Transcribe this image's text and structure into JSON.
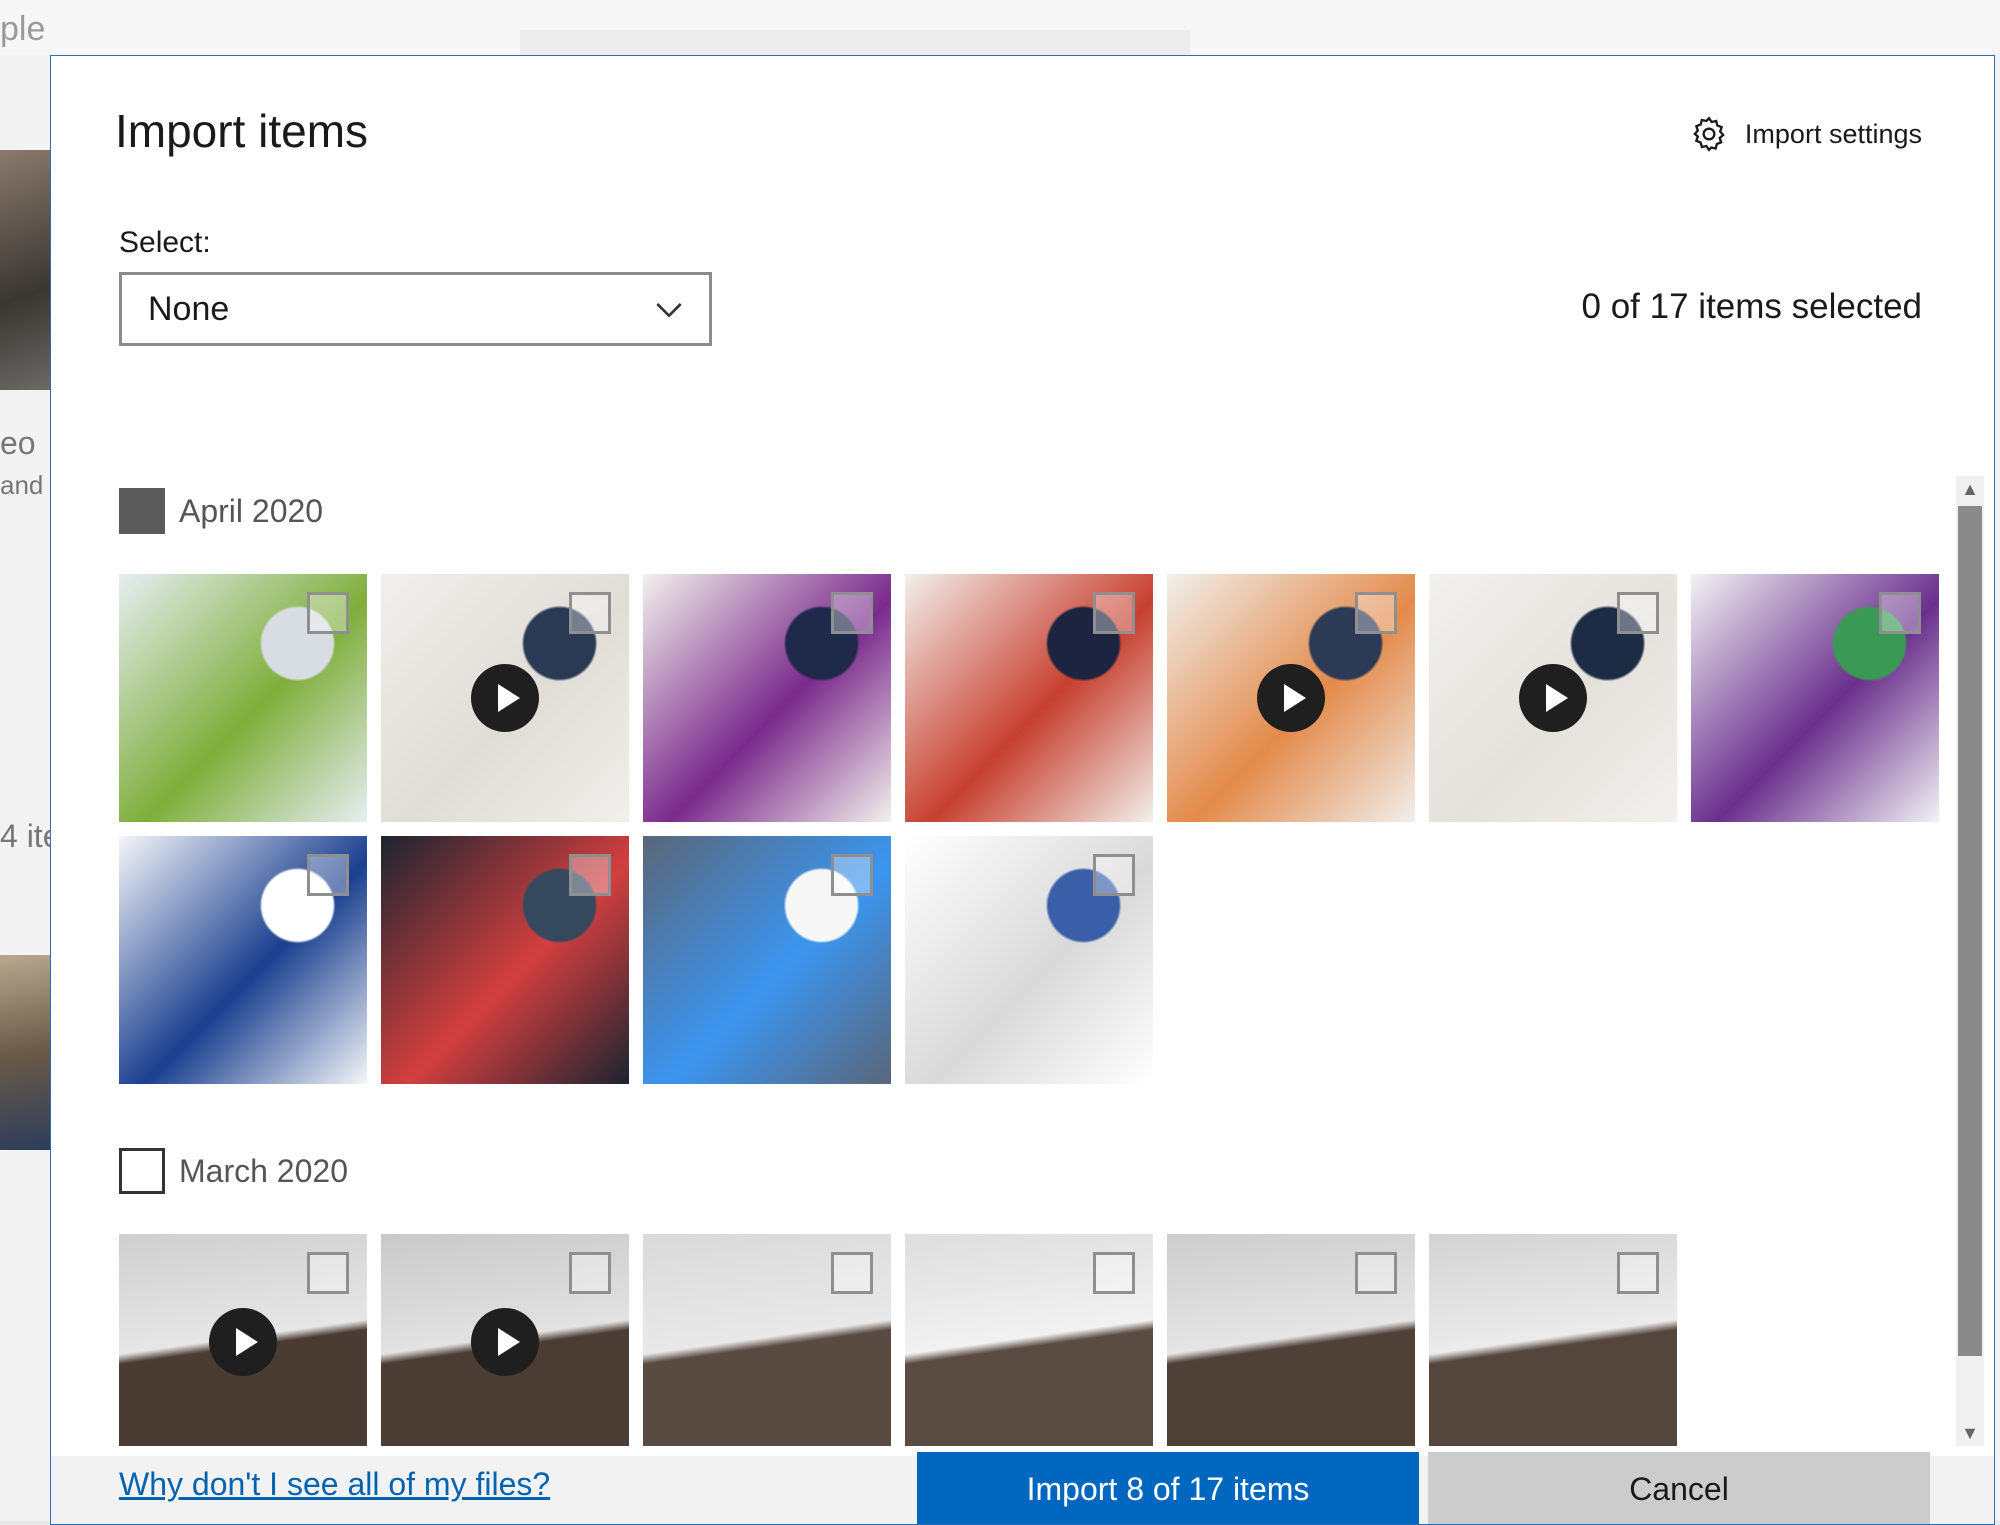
{
  "background_app": {
    "title_fragment": "ple",
    "side_text_1": "eo",
    "side_text_2": "and s",
    "side_text_3": "4 ite"
  },
  "dialog": {
    "title": "Import items",
    "settings_label": "Import settings",
    "settings_icon": "gear-icon",
    "select_label": "Select:",
    "select_value": "None",
    "selection_count": "0 of 17 items selected"
  },
  "groups": [
    {
      "label": "April 2020",
      "checked_state": "partial",
      "items": [
        {
          "kind": "photo",
          "video": false,
          "colors": [
            "#e6eef2",
            "#7fae3c",
            "#d7dde3"
          ]
        },
        {
          "kind": "video",
          "video": true,
          "colors": [
            "#f1efeb",
            "#e0ddd7",
            "#2a3a55"
          ]
        },
        {
          "kind": "photo",
          "video": false,
          "colors": [
            "#f3f1ec",
            "#7a2a8c",
            "#1f2a4a"
          ]
        },
        {
          "kind": "photo",
          "video": false,
          "colors": [
            "#f2f0ec",
            "#c7402f",
            "#1c2440"
          ]
        },
        {
          "kind": "video",
          "video": true,
          "colors": [
            "#f1efec",
            "#e38a4a",
            "#2b3a55"
          ]
        },
        {
          "kind": "video",
          "video": true,
          "colors": [
            "#f2f0ed",
            "#e5e2dc",
            "#1e2b44"
          ]
        },
        {
          "kind": "photo",
          "video": false,
          "colors": [
            "#f2f2f4",
            "#6a2f8c",
            "#3a9a55"
          ]
        },
        {
          "kind": "photo",
          "video": false,
          "colors": [
            "#f4f6f9",
            "#1a3f8f",
            "#ffffff"
          ]
        },
        {
          "kind": "photo",
          "video": false,
          "colors": [
            "#1b2430",
            "#d33f3f",
            "#35485e"
          ]
        },
        {
          "kind": "photo",
          "video": false,
          "colors": [
            "#5a6679",
            "#3b95f0",
            "#f7f7f7"
          ]
        },
        {
          "kind": "photo",
          "video": false,
          "colors": [
            "#ffffff",
            "#d9d9d9",
            "#3a5fa8"
          ]
        }
      ]
    },
    {
      "label": "March 2020",
      "checked_state": "unchecked",
      "items": [
        {
          "kind": "video",
          "video": true,
          "colors": [
            "#cfcfcf",
            "#e6e6e6",
            "#4a3b33"
          ]
        },
        {
          "kind": "video",
          "video": true,
          "colors": [
            "#c9c9c9",
            "#e2e2e2",
            "#4b3c34"
          ]
        },
        {
          "kind": "photo",
          "video": false,
          "colors": [
            "#d9d9d9",
            "#e9e9e9",
            "#5a4b42"
          ]
        },
        {
          "kind": "photo",
          "video": false,
          "colors": [
            "#dedede",
            "#f1f1f1",
            "#5b4c43"
          ]
        },
        {
          "kind": "photo",
          "video": false,
          "colors": [
            "#cdcdcd",
            "#e5e5e5",
            "#4f4038"
          ]
        },
        {
          "kind": "photo",
          "video": false,
          "colors": [
            "#d3d3d3",
            "#ebebeb",
            "#54453d"
          ]
        }
      ]
    }
  ],
  "footer": {
    "help_link": "Why don't I see all of my files?",
    "import_label": "Import 8 of 17 items",
    "cancel_label": "Cancel"
  },
  "colors": {
    "accent": "#0067c0",
    "link": "#0063b1",
    "dialog_border": "#2b6cb6"
  }
}
